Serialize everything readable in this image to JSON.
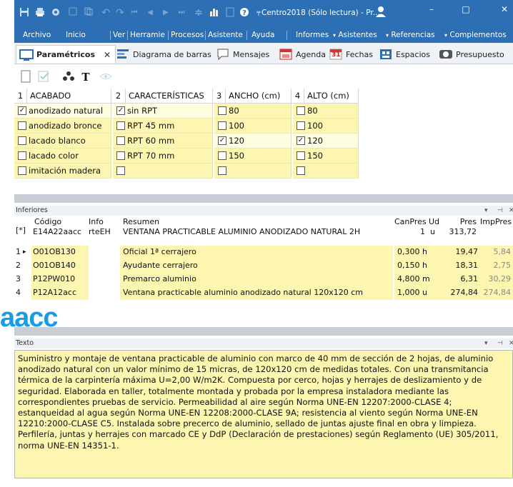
{
  "window": {
    "title": "Centro2018 (Sólo lectura) - Pr...",
    "minimize": "–",
    "maximize": "□",
    "close": "✕"
  },
  "menu": {
    "items": [
      "Archivo",
      "Inicio",
      "Ver",
      "Herramie",
      "Procesos",
      "Asistente",
      "Ayuda",
      "Informes",
      "Asistentes",
      "Referencias",
      "Complementos"
    ]
  },
  "tabs": [
    {
      "label": "Paramétricos",
      "close": "✕"
    },
    {
      "label": "Diagrama de barras"
    },
    {
      "label": "Mensajes"
    },
    {
      "label": "Agenda"
    },
    {
      "label": "Fechas",
      "icon_text": "31"
    },
    {
      "label": "Espacios"
    },
    {
      "label": "Presupuesto"
    }
  ],
  "toolbar_icons": [
    "new-doc-icon",
    "check-doc-icon",
    "group-icon",
    "text-icon",
    "eye-icon"
  ],
  "toolbar_t_label": "T",
  "params": {
    "columns": [
      {
        "num": "1",
        "name": "ACABADO"
      },
      {
        "num": "2",
        "name": "CARACTERÍSTICAS"
      },
      {
        "num": "3",
        "name": "ANCHO (cm)"
      },
      {
        "num": "4",
        "name": "ALTO (cm)"
      }
    ],
    "col1": [
      {
        "label": "anodizado natural",
        "checked": true
      },
      {
        "label": "anodizado bronce",
        "checked": false
      },
      {
        "label": "lacado blanco",
        "checked": false
      },
      {
        "label": "lacado color",
        "checked": false
      },
      {
        "label": "imitación madera",
        "checked": false
      }
    ],
    "col2": [
      {
        "label": "sin RPT",
        "checked": true
      },
      {
        "label": "RPT 45 mm",
        "checked": false
      },
      {
        "label": "RPT 60 mm",
        "checked": false
      },
      {
        "label": "RPT 70 mm",
        "checked": false
      },
      {
        "label": "",
        "checked": false
      }
    ],
    "col3": [
      {
        "label": "80",
        "checked": false
      },
      {
        "label": "100",
        "checked": false
      },
      {
        "label": "120",
        "checked": true
      },
      {
        "label": "150",
        "checked": false
      },
      {
        "label": "",
        "checked": false
      }
    ],
    "col4": [
      {
        "label": "80",
        "checked": false
      },
      {
        "label": "100",
        "checked": false
      },
      {
        "label": "120",
        "checked": true
      },
      {
        "label": "150",
        "checked": false
      },
      {
        "label": "",
        "checked": false
      }
    ]
  },
  "inferiores": {
    "title": "Inferiores",
    "header": {
      "marker": "[*]",
      "codigo_label": "Código",
      "codigo_value": "E14A22aacc",
      "info_label": "Info",
      "info_value": "rteEH",
      "resumen_label": "Resumen",
      "resumen_value": "VENTANA PRACTICABLE ALUMINIO ANODIZADO NATURAL  2H",
      "canpres_label": "CanPres",
      "canpres_value": "1",
      "ud_label": "Ud",
      "ud_value": "u",
      "pres_label": "Pres",
      "pres_value": "313,72",
      "imppres_label": "ImpPres"
    },
    "rows": [
      {
        "num": "1",
        "arrow": "▸",
        "code": "O01OB130",
        "resumen": "Oficial 1ª cerrajero",
        "cant": "0,300 h",
        "pres": "19,47",
        "imp": "5,84"
      },
      {
        "num": "2",
        "arrow": "",
        "code": "O01OB140",
        "resumen": "Ayudante cerrajero",
        "cant": "0,150 h",
        "pres": "18,31",
        "imp": "2,75"
      },
      {
        "num": "3",
        "arrow": "",
        "code": "P12PW010",
        "resumen": "Premarco aluminio",
        "cant": "4,800 m",
        "pres": "6,31",
        "imp": "30,29"
      },
      {
        "num": "4",
        "arrow": "",
        "code": "P12A12acc",
        "resumen": "Ventana practicable aluminio anodizado natural  120x120 cm",
        "cant": "1,000 u",
        "pres": "274,84",
        "imp": "274,84"
      }
    ]
  },
  "texto": {
    "title": "Texto",
    "body": "Suministro y montaje de ventana practicable de aluminio con marco de 40 mm de sección de 2 hojas, de aluminio anodizado natural con un valor mínimo de 15 micras, de 120x120 cm de medidas totales. Con una transmitancia térmica de la carpintería máxima U=2,00 W/m2K. Compuesta por cerco, hojas y herrajes de deslizamiento y de seguridad. Elaborada en taller, totalmente montada y probada por la empresa instaladora mediante las correspondientes pruebas de servicio. Permeabilidad al aire según Norma UNE-EN 12207:2000-CLASE 4; estanqueidad al agua según Norma UNE-EN 12208:2000-CLASE 9A; resistencia al viento según Norma UNE-EN 12210:2000-CLASE C5. Instalada sobre precerco de aluminio, sellado de juntas ajuste final en obra y limpieza. Perfilería, juntas y herrajes con marcado CE y DdP (Declaración de prestaciones) según Reglamento (UE) 305/2011, norma UNE-EN 14351-1."
  },
  "panel_controls": {
    "pin": "⊣",
    "close": "✕",
    "dropdown": "▾"
  },
  "logo": {
    "text": "aacc"
  },
  "colors": {
    "titlebar": "#2d6fb4",
    "param_cell": "#fdf6b0",
    "logo": "#1a9be6"
  }
}
